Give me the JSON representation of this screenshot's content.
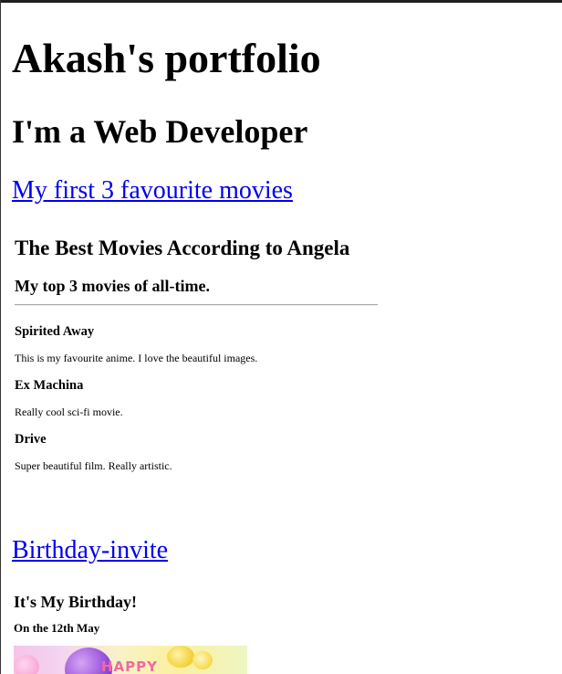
{
  "page": {
    "title": "Akash's portfolio",
    "subtitle": "I'm a Web Developer"
  },
  "links": {
    "movies": "My first 3 favourite movies",
    "birthday": "Birthday-invite"
  },
  "movies_frame": {
    "heading": "The Best Movies According to Angela",
    "subheading": "My top 3 movies of all-time.",
    "movies": [
      {
        "name": "Spirited Away",
        "description": "This is my favourite anime. I love the beautiful images."
      },
      {
        "name": "Ex Machina",
        "description": "Really cool sci-fi movie."
      },
      {
        "name": "Drive",
        "description": "Super beautiful film. Really artistic."
      }
    ]
  },
  "birthday_frame": {
    "heading": "It's My Birthday!",
    "date": "On the 12th May",
    "image_text": "HAPPY"
  },
  "colors": {
    "link": "#0000ee",
    "text": "#000000",
    "background": "#ffffff"
  }
}
